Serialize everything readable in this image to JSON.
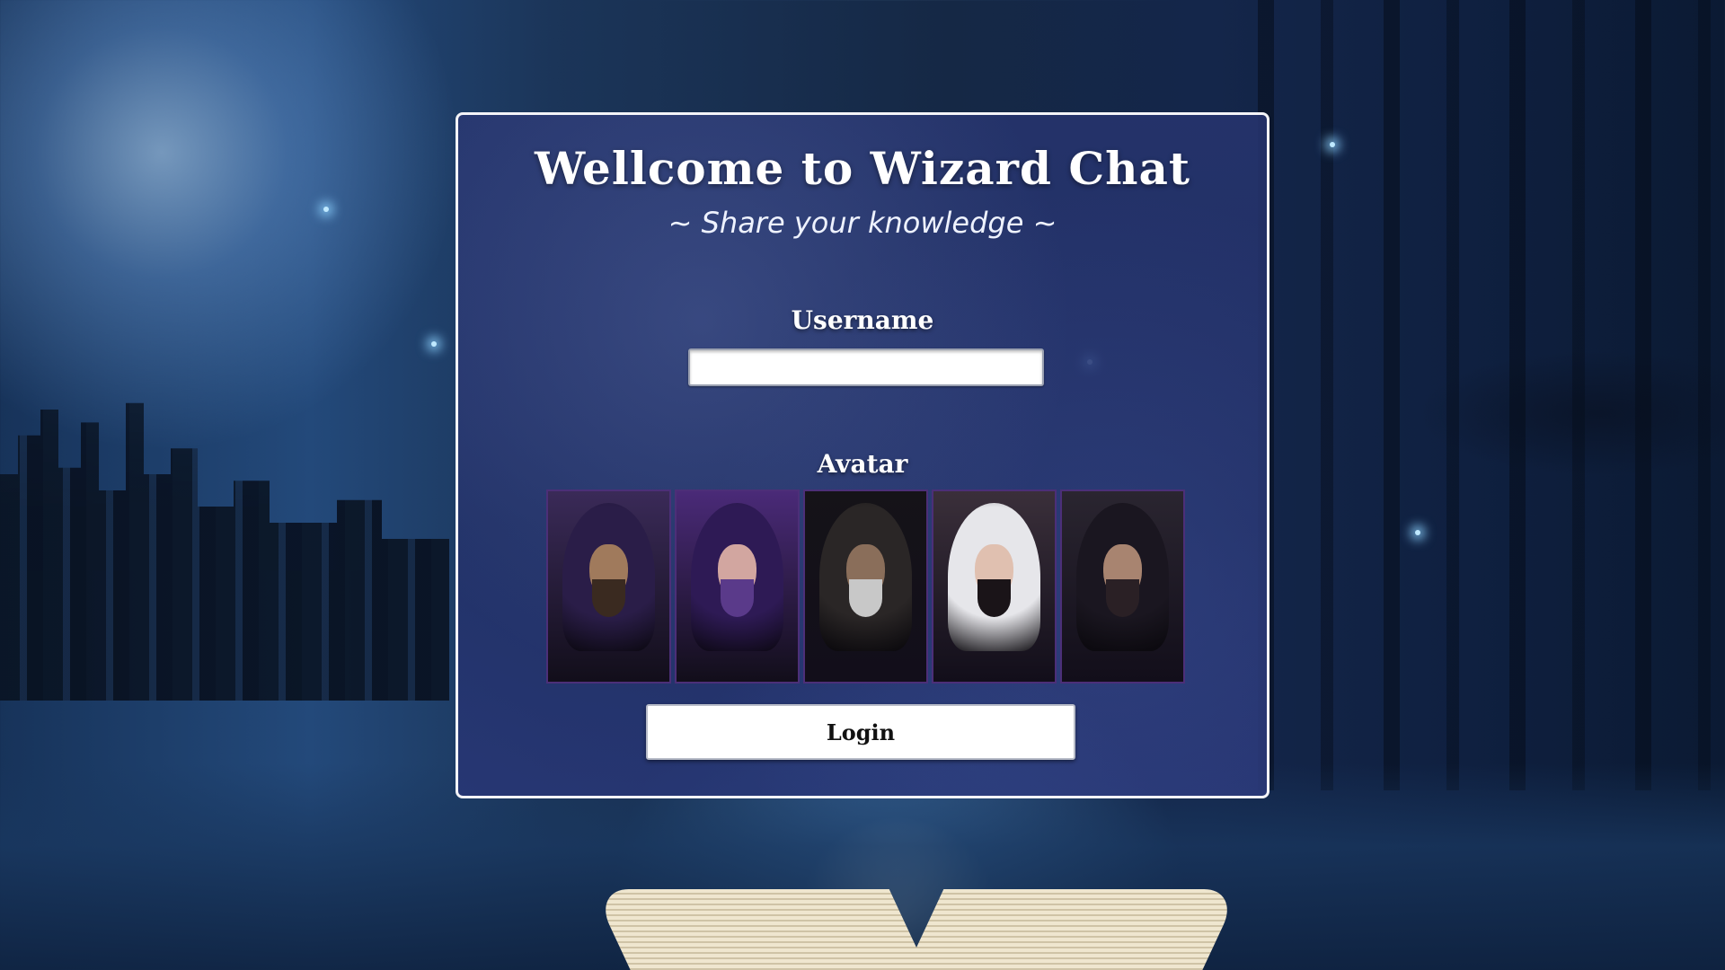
{
  "page": {
    "title": "Wellcome to Wizard Chat",
    "subtitle": "~ Share your knowledge ~"
  },
  "form": {
    "username_label": "Username",
    "username_value": "",
    "avatar_label": "Avatar",
    "login_label": "Login"
  },
  "avatars": [
    {
      "name": "hooded-bearded-man",
      "palette": {
        "bg": "#3a2a58",
        "hood": "#2a1d48",
        "face": "#a07a5c",
        "beard": "#3a2a20"
      }
    },
    {
      "name": "purple-haired-sorceress",
      "palette": {
        "bg": "#4a2a78",
        "hood": "#2e1a55",
        "face": "#d2a6a0",
        "beard": "#5a3a8a"
      }
    },
    {
      "name": "old-grey-wizard",
      "palette": {
        "bg": "#151318",
        "hood": "#2a2626",
        "face": "#8a6e5a",
        "beard": "#c8c8c8"
      }
    },
    {
      "name": "white-haired-woman",
      "palette": {
        "bg": "#3a2f3a",
        "hood": "#e6e6ea",
        "face": "#e0c0b0",
        "beard": "#1a1418"
      }
    },
    {
      "name": "hooded-young-man",
      "palette": {
        "bg": "#2a2530",
        "hood": "#1a1620",
        "face": "#a88470",
        "beard": "#2a2025"
      }
    }
  ]
}
